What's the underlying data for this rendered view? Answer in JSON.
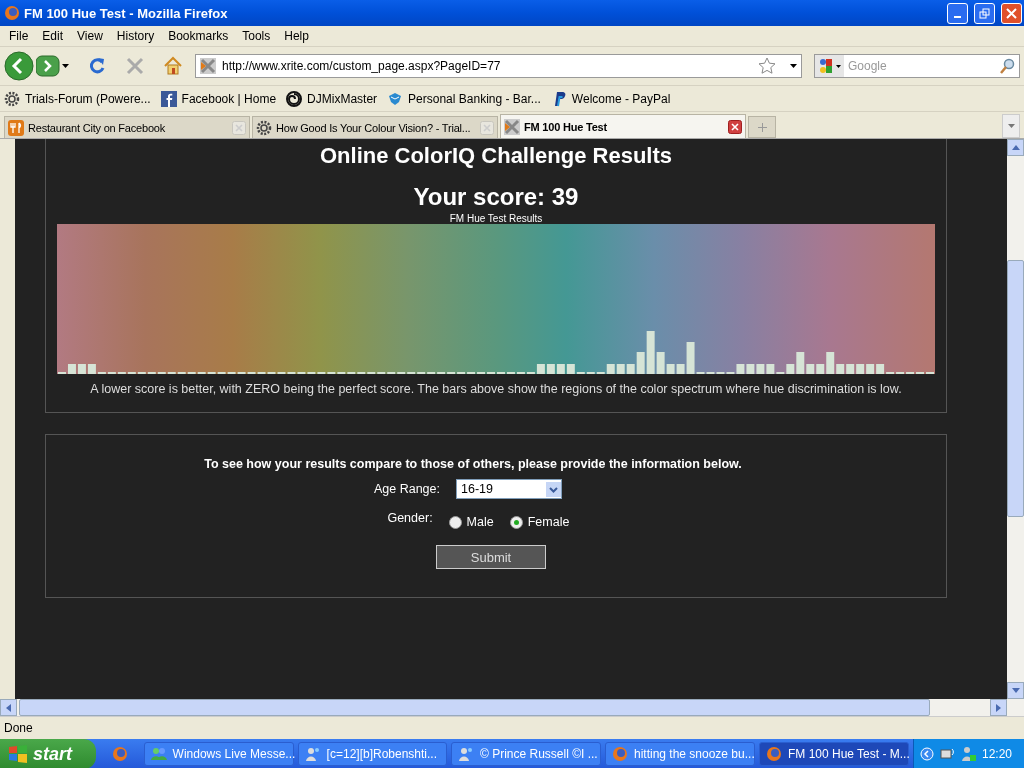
{
  "window": {
    "title": "FM 100 Hue Test - Mozilla Firefox"
  },
  "menu": [
    "File",
    "Edit",
    "View",
    "History",
    "Bookmarks",
    "Tools",
    "Help"
  ],
  "toolbar": {
    "url": "http://www.xrite.com/custom_page.aspx?PageID=77",
    "search_placeholder": "Google"
  },
  "bookmarks": [
    {
      "label": "Trials-Forum (Powere...",
      "kind": "gear"
    },
    {
      "label": "Facebook | Home",
      "kind": "facebook"
    },
    {
      "label": "DJMixMaster",
      "kind": "swirl"
    },
    {
      "label": "Personal Banking - Bar...",
      "kind": "eagle"
    },
    {
      "label": "Welcome - PayPal",
      "kind": "paypal"
    }
  ],
  "tabs": [
    {
      "label": "Restaurant City on Facebook",
      "kind": "fork",
      "selected": false
    },
    {
      "label": "How Good Is Your Colour Vision? - Trial...",
      "kind": "gear",
      "selected": false
    },
    {
      "label": "FM 100 Hue Test",
      "kind": "xrite",
      "selected": true
    }
  ],
  "page": {
    "heading": "Online ColorIQ Challenge Results",
    "score": "Your score: 39",
    "chart_title": "FM Hue Test Results",
    "caption": "A lower score is better, with ZERO being the perfect score. The bars above show the regions of the color spectrum where hue discrimination is low.",
    "form": {
      "intro": "To see how your results compare to those of others, please provide the information below.",
      "age_label": "Age Range:",
      "age_value": "16-19",
      "gender_label": "Gender:",
      "gender_options": [
        {
          "label": "Male",
          "selected": false
        },
        {
          "label": "Female",
          "selected": true
        }
      ],
      "submit": "Submit"
    }
  },
  "status_bar": "Done",
  "taskbar": {
    "start": "start",
    "items": [
      {
        "label": "Windows Live Messe...",
        "kind": "messenger",
        "selected": false
      },
      {
        "label": "[c=12][b]Robenshti...",
        "kind": "chat",
        "selected": false
      },
      {
        "label": "© Prince Russell ©I ...",
        "kind": "chat",
        "selected": false
      },
      {
        "label": "hitting the snooze bu...",
        "kind": "firefox",
        "selected": false
      },
      {
        "label": "FM 100 Hue Test - M...",
        "kind": "firefox",
        "selected": true
      }
    ],
    "clock": "12:20"
  }
}
